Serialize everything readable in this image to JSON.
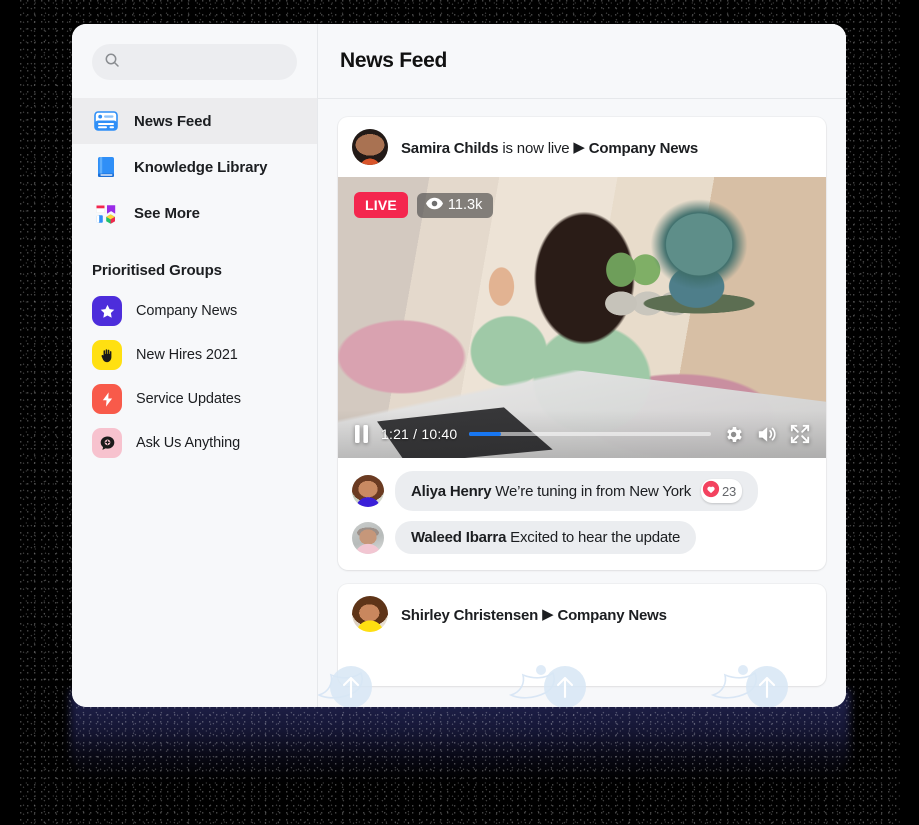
{
  "window": {
    "title": "News Feed"
  },
  "search": {
    "value": "",
    "placeholder": "",
    "icon": "search-icon"
  },
  "sidebar": {
    "nav": [
      {
        "label": "News Feed",
        "icon": "news-feed-icon",
        "active": true
      },
      {
        "label": "Knowledge Library",
        "icon": "book-icon",
        "active": false
      },
      {
        "label": "See More",
        "icon": "apps-grid-icon",
        "active": false
      }
    ],
    "groups_title": "Prioritised Groups",
    "groups": [
      {
        "label": "Company News",
        "icon": "star-icon",
        "bg": "#4D2DDB",
        "fg": "#FFFFFF"
      },
      {
        "label": "New Hires 2021",
        "icon": "hand-wave-icon",
        "bg": "#FFE011",
        "fg": "#1A1A1A"
      },
      {
        "label": "Service Updates",
        "icon": "bolt-icon",
        "bg": "#F85A4A",
        "fg": "#FFFFFF"
      },
      {
        "label": "Ask Us Anything",
        "icon": "chat-plus-icon",
        "bg": "#F7C2CE",
        "fg": "#1A1A1A"
      }
    ]
  },
  "main": {
    "header_title": "News Feed",
    "posts": [
      {
        "author": "Samira Childs",
        "status": " is now live",
        "caret": "▶",
        "group": "Company News",
        "avatar": "samira-childs-avatar",
        "video": {
          "live_label": "LIVE",
          "views": "11.3k",
          "views_icon": "eye-icon",
          "play_state_icon": "pause-icon",
          "current_time": "1:21",
          "separator": "/",
          "duration": "10:40",
          "progress_percent": 13,
          "progress_color": "#1877F2",
          "settings_icon": "gear-icon",
          "volume_icon": "volume-icon",
          "fullscreen_icon": "fullscreen-icon"
        },
        "comments": [
          {
            "author": "Aliya Henry",
            "text": " We’re tuning in from New York",
            "avatar": "aliya-henry-avatar",
            "reaction": {
              "icon": "heart-icon",
              "color": "#F3425F",
              "count": "23"
            }
          },
          {
            "author": "Waleed Ibarra",
            "text": " Excited to hear the update",
            "avatar": "waleed-ibarra-avatar",
            "reaction": null
          }
        ]
      },
      {
        "author": "Shirley Christensen",
        "status": "",
        "caret": "▶",
        "group": "Company News",
        "avatar": "shirley-christensen-avatar"
      }
    ]
  },
  "colors": {
    "live_red": "#F4264E",
    "accent_blue": "#1877F2",
    "sidebar_bg": "#F7F8FA",
    "active_nav_bg": "#ECECEE",
    "bubble_bg": "#EBEDF0",
    "page_bg": "#000000"
  }
}
